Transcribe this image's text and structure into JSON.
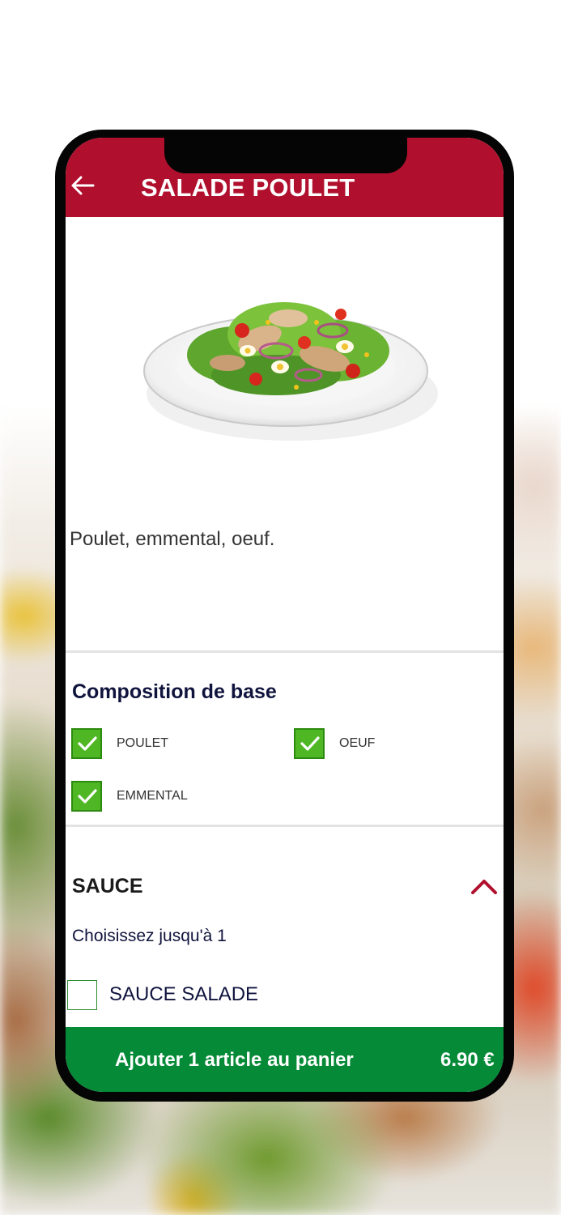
{
  "header": {
    "title": "SALADE POULET",
    "back_icon": "arrow-left-icon",
    "background_color": "#b0102d"
  },
  "product": {
    "image": "salad-plate-image",
    "description": "Poulet, emmental, oeuf."
  },
  "base_composition": {
    "title": "Composition de base",
    "items": [
      {
        "label": "POULET",
        "checked": true
      },
      {
        "label": "OEUF",
        "checked": true
      },
      {
        "label": "EMMENTAL",
        "checked": true
      }
    ],
    "check_color": "#4fb723"
  },
  "sauce": {
    "title": "SAUCE",
    "expand_icon": "chevron-up-icon",
    "hint": "Choisissez jusqu'à 1",
    "options": [
      {
        "label": "SAUCE SALADE",
        "checked": false
      }
    ]
  },
  "cart_button": {
    "label": "Ajouter 1 article au panier",
    "price": "6.90 €",
    "background_color": "#058a37"
  }
}
